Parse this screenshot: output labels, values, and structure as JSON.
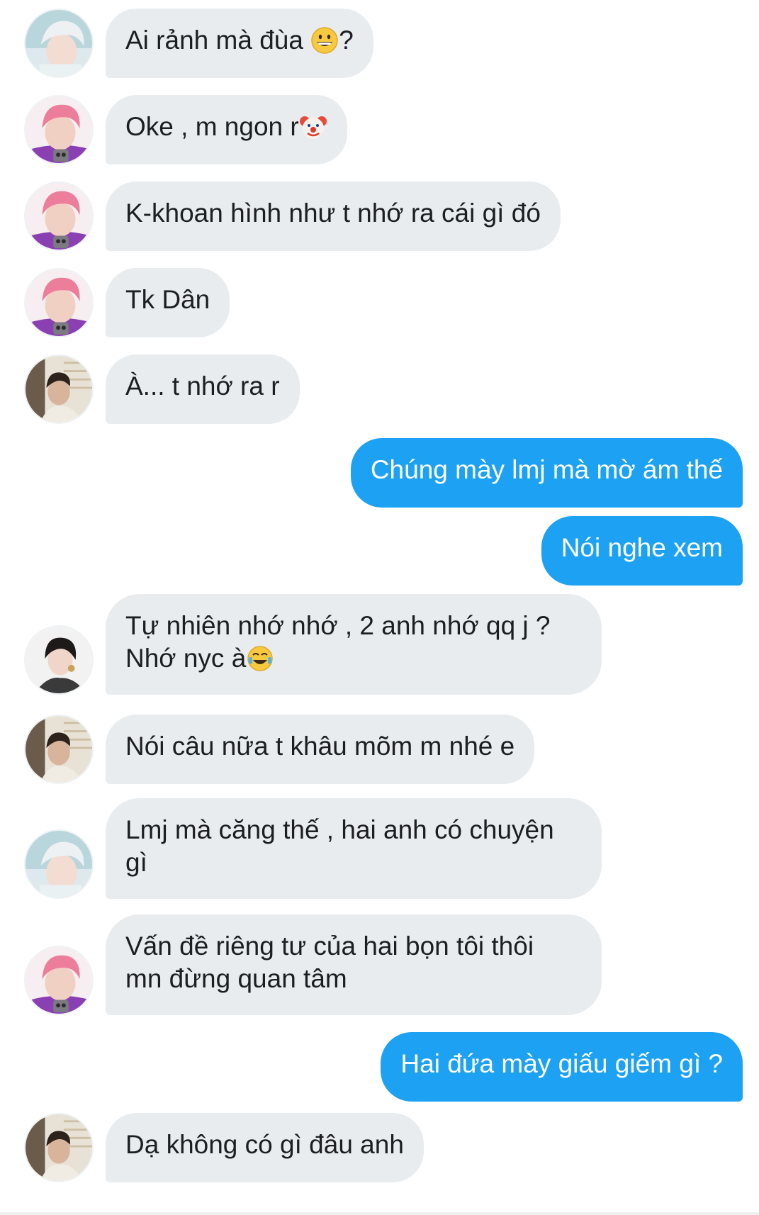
{
  "colors": {
    "incoming_bubble": "#e9ecef",
    "outgoing_bubble": "#1da1f2",
    "incoming_text": "#1c1e21",
    "outgoing_text": "#ffffff"
  },
  "messages": [
    {
      "direction": "incoming",
      "avatar": "silver-hair-avatar",
      "text": "Ai rảnh mà đùa ",
      "emoji": "grinning-face-emoji",
      "suffix": "?"
    },
    {
      "direction": "incoming",
      "avatar": "pink-hair-avatar",
      "text": "Oke , m ngon r",
      "emoji": "clown-face-emoji",
      "suffix": ""
    },
    {
      "direction": "incoming",
      "avatar": "pink-hair-avatar",
      "text": "K-khoan hình như t nhớ ra cái gì đó"
    },
    {
      "direction": "incoming",
      "avatar": "pink-hair-avatar",
      "text": "Tk Dân"
    },
    {
      "direction": "incoming",
      "avatar": "dark-hair-window-avatar",
      "text": "À... t nhớ ra r"
    },
    {
      "direction": "outgoing",
      "text": "Chúng mày lmj mà mờ ám thế"
    },
    {
      "direction": "outgoing",
      "text": "Nói nghe xem"
    },
    {
      "direction": "incoming",
      "avatar": "dark-hair-avatar",
      "line1": "Tự nhiên nhớ nhớ , 2 anh nhớ qq j ?",
      "line2": "Nhớ nyc à",
      "emoji": "tears-of-joy-emoji"
    },
    {
      "direction": "incoming",
      "avatar": "dark-hair-window-avatar",
      "text": "Nói câu nữa t khâu mõm m nhé e"
    },
    {
      "direction": "incoming",
      "avatar": "silver-hair-avatar",
      "line1": "Lmj mà căng thế , hai anh có chuyện",
      "line2": "gì"
    },
    {
      "direction": "incoming",
      "avatar": "pink-hair-avatar",
      "line1": "Vấn đề riêng tư của hai bọn tôi thôi",
      "line2": "mn đừng quan tâm"
    },
    {
      "direction": "outgoing",
      "text": "Hai đứa mày giấu giếm gì ?"
    },
    {
      "direction": "incoming",
      "avatar": "dark-hair-window-avatar",
      "text": "Dạ không có gì đâu anh"
    }
  ]
}
